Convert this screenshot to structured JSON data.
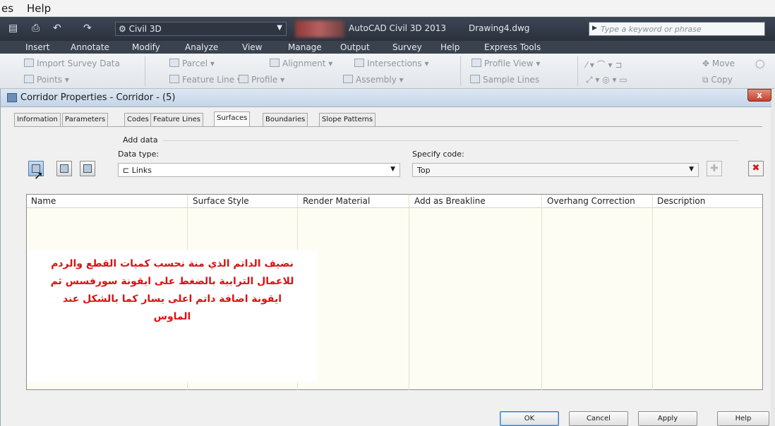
{
  "menubar": {
    "items": [
      "es",
      "Help"
    ]
  },
  "quick_access": {
    "workspace": "Civil 3D",
    "app_title": "AutoCAD Civil 3D 2013",
    "drawing": "Drawing4.dwg",
    "search_placeholder": "Type a keyword or phrase"
  },
  "ribbon": {
    "tabs": [
      "Insert",
      "Annotate",
      "Modify",
      "Analyze",
      "View",
      "Manage",
      "Output",
      "Survey",
      "Help",
      "Express Tools"
    ],
    "row1": [
      "Import Survey Data",
      "Parcel ▾",
      "Alignment ▾",
      "Intersections ▾",
      "Profile View ▾",
      "Move"
    ],
    "row2": [
      "Points ▾",
      "Feature Line ▾",
      "Profile ▾",
      "Assembly ▾",
      "Sample Lines",
      "Copy"
    ]
  },
  "dialog": {
    "title": "Corridor Properties - Corridor - (5)",
    "close_label": "x",
    "tabs": [
      "Information",
      "Parameters",
      "Codes",
      "Feature Lines",
      "Surfaces",
      "Boundaries",
      "Slope Patterns"
    ],
    "active_tab": "Surfaces",
    "add_data_label": "Add data",
    "data_type_label": "Data type:",
    "data_type_value": "Links",
    "specify_code_label": "Specify code:",
    "specify_code_value": "Top",
    "columns": [
      "Name",
      "Surface Style",
      "Render Material",
      "Add as Breakline",
      "Overhang Correction",
      "Description"
    ],
    "annotation_lines": [
      "نضيف الداتم الذي منة نحسب كميات القطع والردم",
      "للاعمال الترابية بالضغط على ايقونة سورفسس ثم",
      "ايقونة اضافة داتم اعلى يسار  كما بالشكل عند",
      "الماوس"
    ],
    "buttons": {
      "ok": "OK",
      "cancel": "Cancel",
      "apply": "Apply",
      "help": "Help"
    }
  }
}
